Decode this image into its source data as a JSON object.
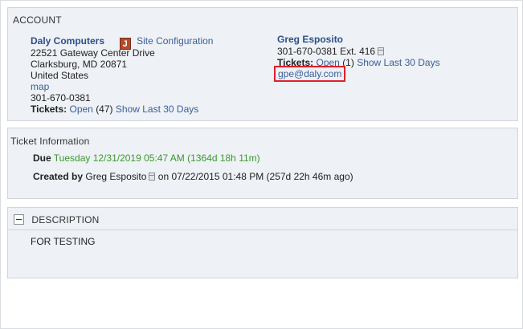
{
  "account": {
    "header": "ACCOUNT",
    "company_name": "Daly Computers",
    "badge_letter": "J",
    "site_config_label": "Site Configuration",
    "address1": "22521 Gateway Center Drive",
    "address2": "Clarksburg, MD 20871",
    "country": "United States",
    "map_label": "map",
    "phone": "301-670-0381",
    "tickets_label": "Tickets:",
    "open_label": "Open",
    "open_count": "(47)",
    "show_last_label": "Show Last 30 Days"
  },
  "contact": {
    "name": "Greg Esposito",
    "phone": "301-670-0381 Ext. 416",
    "tickets_label": "Tickets:",
    "open_label": "Open",
    "open_count": "(1)",
    "show_last_label": "Show Last 30 Days",
    "email": "gpe@daly.com"
  },
  "ticket_info": {
    "header": "Ticket Information",
    "due_label": "Due",
    "due_value": "Tuesday 12/31/2019 05:47 AM (1364d 18h 11m)",
    "created_label": "Created by",
    "created_by": "Greg Esposito",
    "created_on": "on 07/22/2015 01:48 PM (257d 22h 46m ago)"
  },
  "description": {
    "header": "DESCRIPTION",
    "text": "FOR TESTING"
  },
  "colors": {
    "link": "#3a5e9b",
    "due_green": "#3a9a2a",
    "panel_bg": "#eef1f6",
    "highlight_red": "#e0202a"
  }
}
